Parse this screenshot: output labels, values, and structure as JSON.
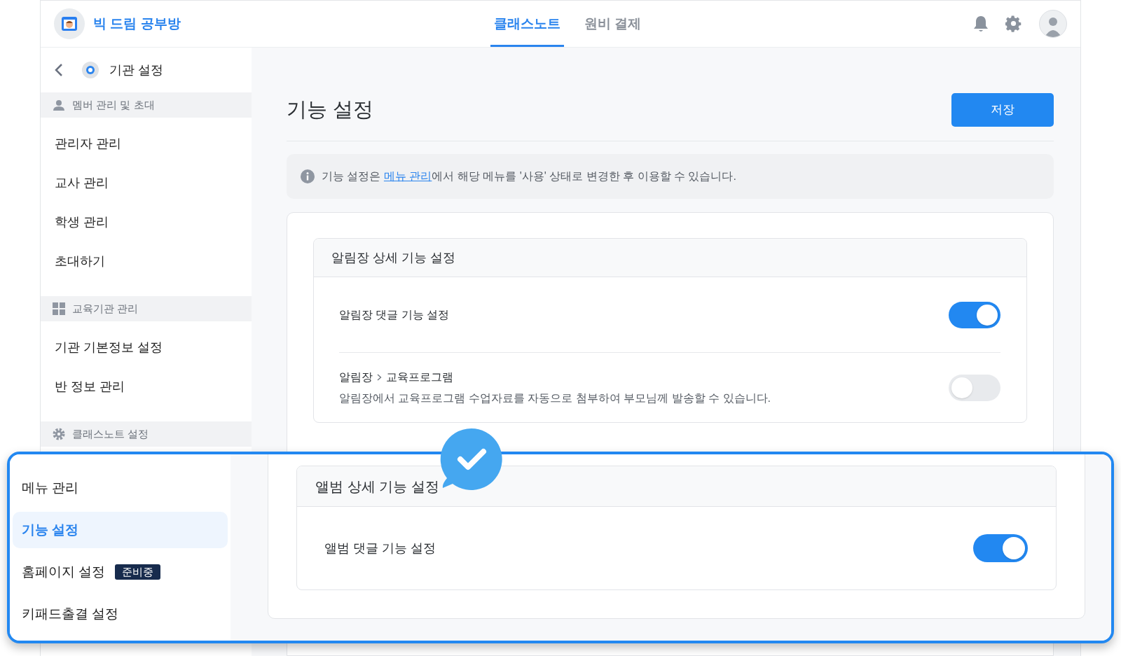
{
  "header": {
    "brand": "빅 드림 공부방",
    "tabs": [
      {
        "label": "클래스노트",
        "selected": true
      },
      {
        "label": "원비 결제",
        "selected": false
      }
    ]
  },
  "sidebar": {
    "title": "기관 설정",
    "sections": [
      {
        "kind": "person",
        "title": "멤버 관리 및 초대",
        "items": [
          {
            "label": "관리자 관리",
            "selected": false
          },
          {
            "label": "교사 관리",
            "selected": false
          },
          {
            "label": "학생 관리",
            "selected": false
          },
          {
            "label": "초대하기",
            "selected": false
          }
        ]
      },
      {
        "kind": "grid",
        "title": "교육기관 관리",
        "items": [
          {
            "label": "기관 기본정보 설정",
            "selected": false
          },
          {
            "label": "반 정보 관리",
            "selected": false
          }
        ]
      },
      {
        "kind": "gear",
        "title": "클래스노트 설정"
      }
    ]
  },
  "page": {
    "title": "기능 설정",
    "save_button": "저장",
    "notice": {
      "before": "기능 설정은 ",
      "link": "메뉴 관리",
      "after": "에서 해당 메뉴를 '사용' 상태로 변경한 후 이용할 수 있습니다."
    },
    "section": {
      "title": "알림장 상세 기능 설정",
      "settings": [
        {
          "label": "알림장 댓글 기능 설정",
          "on": true
        },
        {
          "label": "알림장",
          "sublabel": "교육프로그램",
          "description": "알림장에서 교육프로그램 수업자료를 자동으로 첨부하여 부모님께 발송할 수 있습니다.",
          "on": false
        }
      ]
    }
  },
  "callout": {
    "menu": [
      {
        "label": "메뉴 관리",
        "selected": false
      },
      {
        "label": "기능 설정",
        "selected": true
      },
      {
        "label": "홈페이지 설정",
        "badge": "준비중",
        "selected": false
      },
      {
        "label": "키패드출결 설정",
        "selected": false
      }
    ],
    "section": {
      "title": "앨범 상세 기능 설정",
      "settings": [
        {
          "label": "앨범 댓글 기능 설정",
          "on": true
        }
      ]
    }
  }
}
